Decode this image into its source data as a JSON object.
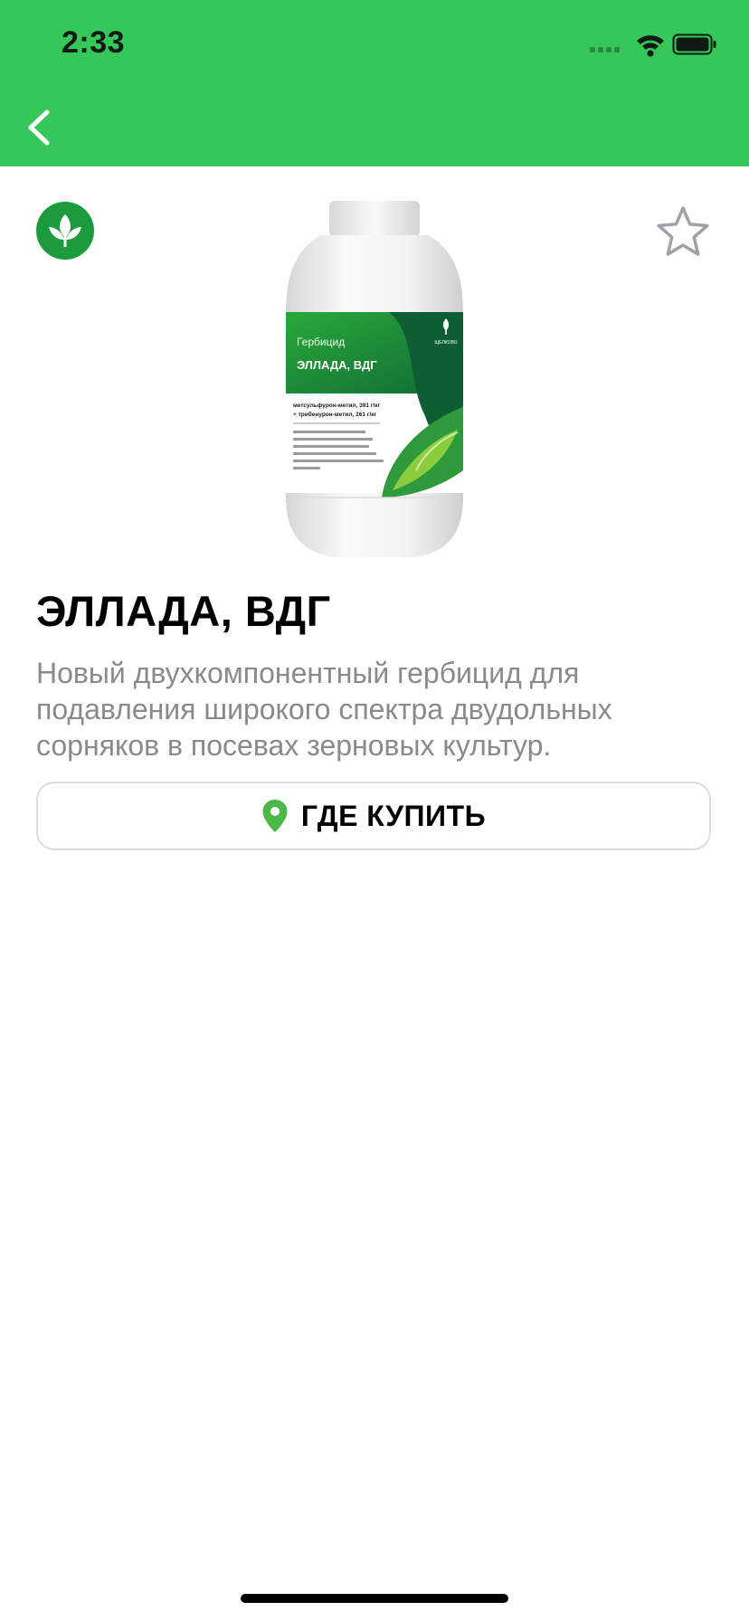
{
  "status_bar": {
    "time": "2:33",
    "icons": [
      "cellular-signal-icon",
      "wifi-icon",
      "battery-icon"
    ]
  },
  "nav": {
    "back_icon": "chevron-left-icon"
  },
  "colors": {
    "header_bg": "#36c75a",
    "brand_green": "#1b9a3e",
    "pin_green": "#4cb848",
    "description_gray": "#8a8a8e",
    "star_gray": "#a0a0a8"
  },
  "product": {
    "title": "ЭЛЛАДА, ВДГ",
    "description": "Новый двухкомпонентный гербицид для подавления широкого спектра двудольных сорняков в посевах зерновых культур.",
    "where_to_buy_label": "ГДЕ КУПИТЬ",
    "favorite_icon": "star-outline-icon",
    "brand_icon": "leaf-logo-icon",
    "package_label": {
      "category": "Гербицид",
      "name": "ЭЛЛАДА, ВДГ",
      "ingredient_1": "метсульфурон-метил, 391 г/кг",
      "ingredient_2": "+ трибенурон-метил, 261 г/кг",
      "brand": "ЩЕЛКОВО"
    }
  }
}
